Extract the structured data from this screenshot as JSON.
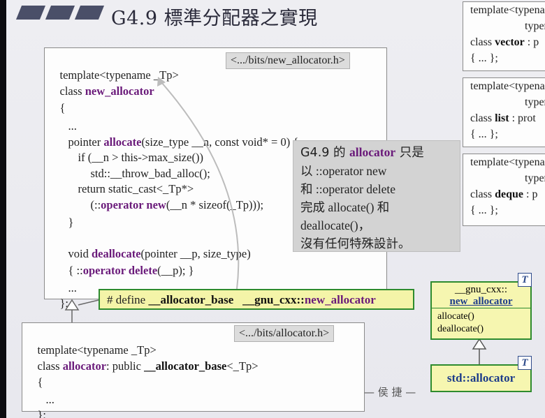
{
  "title": "G4.9 標準分配器之實現",
  "new_allocator_box": {
    "path": "<.../bits/new_allocator.h>",
    "lines": [
      "template<typename _Tp>",
      "class ",
      "new_allocator",
      "{",
      "...",
      "pointer ",
      "allocate",
      "(size_type __n, const void* = 0) {",
      "if (__n > this->max_size())",
      "std::__throw_bad_alloc();",
      "return static_cast<_Tp*>",
      "(::",
      "operator new",
      "(__n * sizeof(_Tp)));",
      "}",
      "void ",
      "deallocate",
      "(pointer __p, size_type)",
      "{ ::",
      "operator delete",
      "(__p); }",
      "...",
      "};"
    ]
  },
  "note": {
    "l1a": "G4.9 的 ",
    "l1b": "allocator",
    "l1c": " 只是",
    "l2": "以 ::operator new",
    "l3": "和 ::operator delete",
    "l4": "完成 allocate() 和",
    "l5": "deallocate()，",
    "l6": "沒有任何特殊設計。"
  },
  "define": {
    "prefix": "# define ",
    "macro": "__allocator_base",
    "ns": "__gnu_cxx::",
    "target": "new_allocator"
  },
  "allocator_box": {
    "path": "<.../bits/allocator.h>",
    "l1": "template<typename _Tp>",
    "l2a": "class ",
    "l2b": "allocator",
    "l2c": ": public ",
    "l2d": "__allocator_base",
    "l2e": "<_Tp>",
    "l3": "{",
    "l4": "...",
    "l5": "};"
  },
  "author": "— 侯 捷 —",
  "right_panels": [
    {
      "l1": "template<typename",
      "l2": "typename",
      "l3a": "class ",
      "l3b": "vector",
      "l3c": " : p",
      "l4": "{ ... };"
    },
    {
      "l1": "template<typename",
      "l2": "typename",
      "l3a": "class ",
      "l3b": "list",
      "l3c": " : prot",
      "l4": "{ ... };"
    },
    {
      "l1": "template<typename",
      "l2": "typename",
      "l3a": "class ",
      "l3b": "deque",
      "l3c": " : p",
      "l4": "{ ... };"
    }
  ],
  "uml_new_allocator": {
    "ns": "__gnu_cxx::",
    "name": "new_allocator",
    "m1": "allocate()",
    "m2": "deallocate()",
    "tag": "T"
  },
  "uml_std_allocator": {
    "name": "std::allocator",
    "tag": "T"
  },
  "colors": {
    "keyword": "#6a1a7a",
    "uml_fill": "#f6f6b0",
    "uml_border": "#2e8b2e",
    "header_bars": "#4a4f68"
  }
}
